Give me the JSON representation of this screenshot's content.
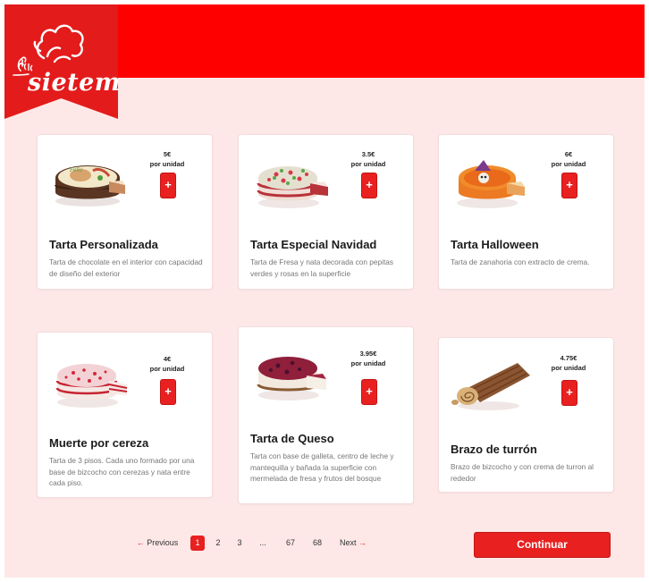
{
  "brand": {
    "name": "sietem",
    "primary_color": "#fe0000",
    "accent_color": "#e82020",
    "background_color": "#fde8e7"
  },
  "products": [
    {
      "title": "Tarta Personalizada",
      "price": "5€",
      "unit": "por unidad",
      "add_label": "+",
      "description": "Tarta de chocolate en el interior con capacidad de diseño del exterior",
      "image_icon": "decorated-cake-image"
    },
    {
      "title": "Tarta Especial Navidad",
      "price": "3.5€",
      "unit": "por unidad",
      "add_label": "+",
      "description": "Tarta de Fresa y nata decorada con pepitas verdes y rosas en la superficie",
      "image_icon": "christmas-cake-image"
    },
    {
      "title": "Tarta Halloween",
      "price": "6€",
      "unit": "por unidad",
      "add_label": "+",
      "description": "Tarta de zanahoria con extracto de crema.",
      "image_icon": "halloween-cake-image"
    },
    {
      "title": "Muerte por cereza",
      "price": "4€",
      "unit": "por unidad",
      "add_label": "+",
      "description": "Tarta de 3 pisos. Cada uno formado por una base de bizcocho con cerezas y nata entre cada piso.",
      "image_icon": "cherry-cake-image"
    },
    {
      "title": "Tarta de Queso",
      "price": "3.95€",
      "unit": "por unidad",
      "add_label": "+",
      "description": "Tarta con base de galleta, centro de leche y mantequilla y bañada la superficie con mermelada de fresa y frutos del bosque",
      "image_icon": "cheesecake-image"
    },
    {
      "title": "Brazo de turrón",
      "price": "4.75€",
      "unit": "por unidad",
      "add_label": "+",
      "description": "Brazo de bizcocho y con crema de turron al rededor",
      "image_icon": "nougat-roll-image"
    }
  ],
  "pagination": {
    "previous_label": "Previous",
    "next_label": "Next",
    "pages": [
      "1",
      "2",
      "3",
      "...",
      "67",
      "68"
    ],
    "current_page": "1"
  },
  "continue_label": "Continuar"
}
